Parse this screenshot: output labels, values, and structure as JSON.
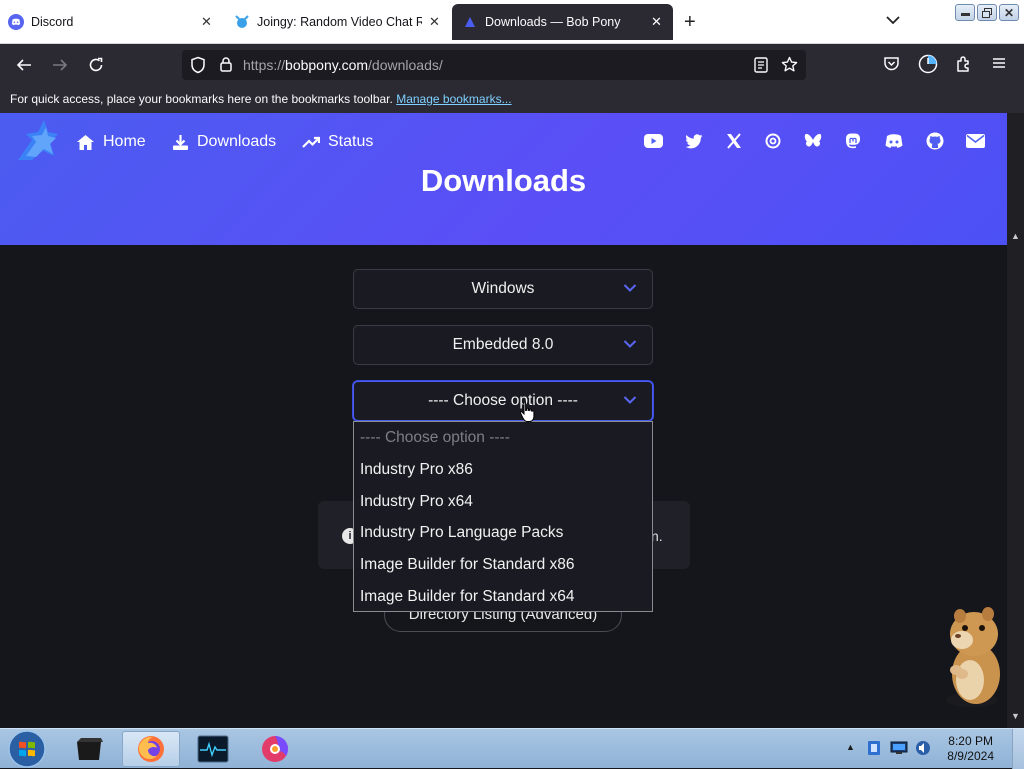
{
  "browser": {
    "tabs": [
      {
        "title": "Discord"
      },
      {
        "title": "Joingy: Random Video Chat Ro"
      },
      {
        "title": "Downloads — Bob Pony"
      }
    ],
    "url_prefix": "https://",
    "url_host": "bobpony.com",
    "url_path": "/downloads/",
    "bookmarks_hint": "For quick access, place your bookmarks here on the bookmarks toolbar.",
    "bookmarks_link": "Manage bookmarks..."
  },
  "site": {
    "nav": [
      {
        "label": "Home",
        "icon": "home-icon"
      },
      {
        "label": "Downloads",
        "icon": "download-icon"
      },
      {
        "label": "Status",
        "icon": "trending-up-icon"
      }
    ],
    "social_icons": [
      "youtube-icon",
      "twitter-icon",
      "x-icon",
      "threads-icon",
      "bluesky-icon",
      "mastodon-icon",
      "discord-icon",
      "github-icon",
      "email-icon"
    ],
    "page_title": "Downloads",
    "accent": "#4b5cf0"
  },
  "form": {
    "os_select": "Windows",
    "version_select": "Embedded 8.0",
    "edition_select": "---- Choose option ----",
    "dropdown_options": [
      "---- Choose option ----",
      "Industry Pro x86",
      "Industry Pro x64",
      "Industry Pro Language Packs",
      "Image Builder for Standard x86",
      "Image Builder for Standard x64"
    ],
    "notice_tail": "n.",
    "directory_button": "Directory Listing (Advanced)"
  },
  "taskbar": {
    "time": "8:20 PM",
    "date": "8/9/2024"
  }
}
